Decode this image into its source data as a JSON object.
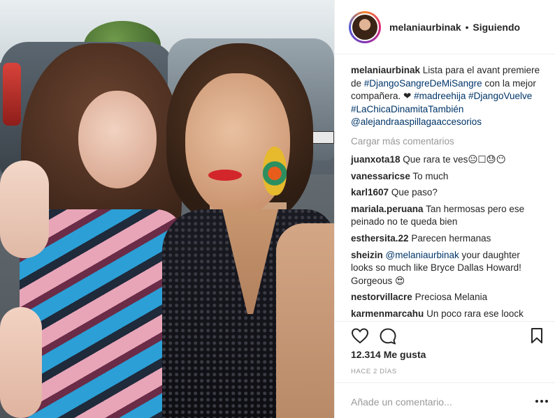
{
  "post": {
    "username": "melaniaurbinak",
    "separator": "•",
    "follow_status": "Siguiendo",
    "caption": {
      "username": "melaniaurbinak",
      "text_1": " Lista para el avant premiere de ",
      "tag_1": "#DjangoSangreDeMiSangre",
      "text_2": " con la mejor compañera. ❤ ",
      "tag_2": "#madreehija",
      "tag_3": "#DjangoVuelve",
      "tag_4": "#LaChicaDinamitaTambién",
      "mention": "@alejandraaspillagaaccesorios"
    },
    "load_more": "Cargar más comentarios",
    "comments": [
      {
        "user": "juanxota18",
        "text": "Que rara te ves😐☐😓😶"
      },
      {
        "user": "vanessaricse",
        "text": "To much"
      },
      {
        "user": "karl1607",
        "text": "Que paso?"
      },
      {
        "user": "mariala.peruana",
        "text": "Tan hermosas pero ese peinado no te queda bien"
      },
      {
        "user": "esthersita.22",
        "text": "Parecen hermanas"
      },
      {
        "user": "sheizin",
        "mention": "@melaniaurbinak",
        "text": " your daughter looks so much like Bryce Dallas Howard! Gorgeous 😍"
      },
      {
        "user": "nestorvillacre",
        "text": "Preciosa Melania"
      },
      {
        "user": "karmenmarcahu",
        "text": "Un poco rara ese loock"
      }
    ],
    "likes": "12.314 Me gusta",
    "timestamp": "HACE 2 DÍAS",
    "comment_placeholder": "Añade un comentario...",
    "icons": [
      "heart-icon",
      "comment-icon",
      "bookmark-icon",
      "more-options-icon"
    ]
  }
}
